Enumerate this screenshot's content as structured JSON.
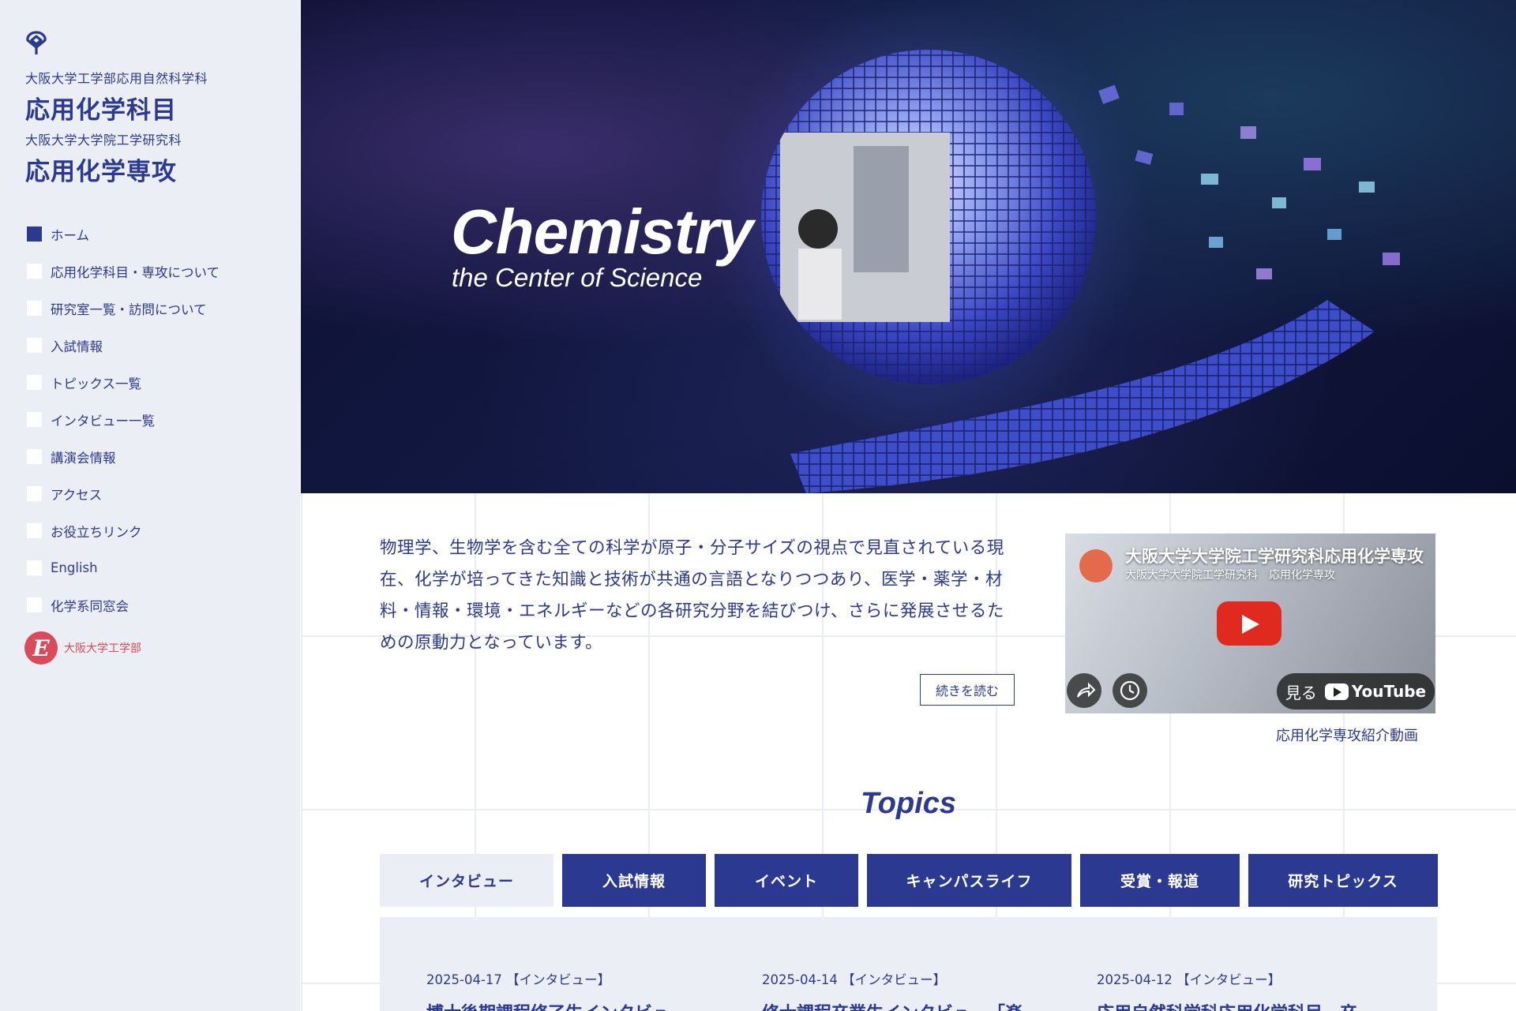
{
  "sidebar": {
    "faculty_line1": "大阪大学工学部応用自然科学科",
    "dept_name1": "応用化学科目",
    "faculty_line2": "大阪大学大学院工学研究科",
    "dept_name2": "応用化学専攻",
    "nav": [
      {
        "label": "ホーム",
        "active": true
      },
      {
        "label": "応用化学科目・専攻について"
      },
      {
        "label": "研究室一覧・訪問について"
      },
      {
        "label": "入試情報"
      },
      {
        "label": "トピックス一覧"
      },
      {
        "label": "インタビュー一覧"
      },
      {
        "label": "講演会情報"
      },
      {
        "label": "アクセス"
      },
      {
        "label": "お役立ちリンク"
      },
      {
        "label": "English"
      },
      {
        "label": "化学系同窓会"
      }
    ],
    "eng_logo_text": "大阪大学工学部"
  },
  "hero": {
    "title": "Chemistry",
    "subtitle": "the Center of Science"
  },
  "intro": {
    "text": "物理学、生物学を含む全ての科学が原子・分子サイズの視点で見直されている現在、化学が培ってきた知識と技術が共通の言語となりつつあり、医学・薬学・材料・情報・環境・エネルギーなどの各研究分野を結びつけ、さらに発展させるための原動力となっています。",
    "read_more": "続きを読む"
  },
  "video": {
    "title": "大阪大学大学院工学研究科応用化学専攻",
    "channel": "大阪大学大学院工学研究科　応用化学専攻",
    "watch_label": "見る",
    "youtube_label": "YouTube",
    "caption": "応用化学専攻紹介動画"
  },
  "topics": {
    "heading": "Topics",
    "tabs": [
      "インタビュー",
      "入試情報",
      "イベント",
      "キャンパスライフ",
      "受賞・報道",
      "研究トピックス"
    ],
    "cards": [
      {
        "date": "2025-04-17 【インタビュー】",
        "title": "博士後期課程修了生インタビュー"
      },
      {
        "date": "2025-04-14 【インタビュー】",
        "title": "修士課程卒業生インタビュー「楽"
      },
      {
        "date": "2025-04-12 【インタビュー】",
        "title": "応用自然科学科応用化学科目　卒"
      }
    ]
  }
}
